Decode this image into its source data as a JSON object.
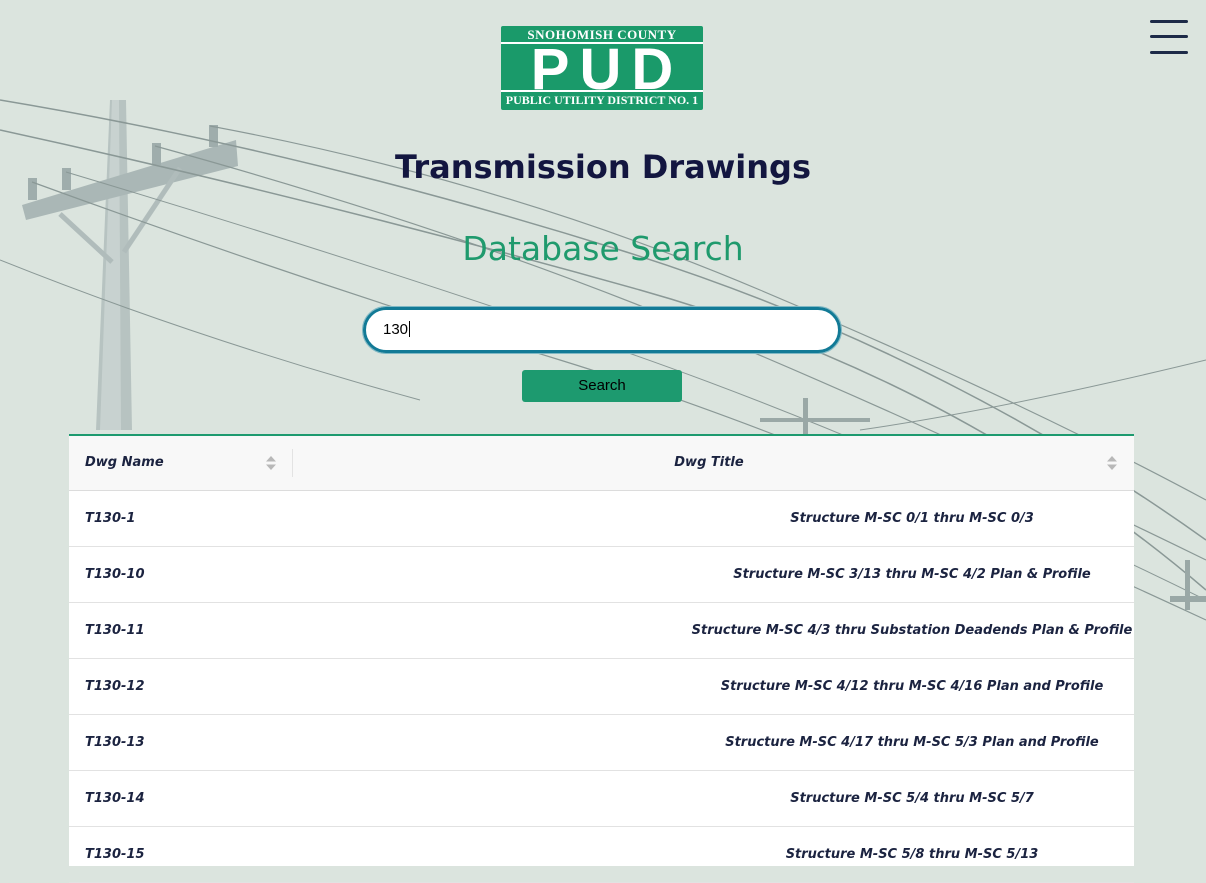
{
  "logo": {
    "top_text": "SNOHOMISH COUNTY",
    "main_text": "PUD",
    "bottom_text": "PUBLIC UTILITY DISTRICT NO. 1"
  },
  "page": {
    "title": "Transmission Drawings",
    "subtitle": "Database Search"
  },
  "search": {
    "value": "130",
    "button_label": "Search"
  },
  "table": {
    "columns": [
      "Dwg Name",
      "Dwg Title"
    ],
    "rows": [
      {
        "name": "T130-1",
        "title": "Structure M-SC 0/1 thru M-SC 0/3"
      },
      {
        "name": "T130-10",
        "title": "Structure M-SC 3/13 thru M-SC 4/2 Plan & Profile"
      },
      {
        "name": "T130-11",
        "title": "Structure M-SC 4/3 thru Substation Deadends Plan & Profile"
      },
      {
        "name": "T130-12",
        "title": "Structure M-SC 4/12 thru M-SC 4/16 Plan and Profile"
      },
      {
        "name": "T130-13",
        "title": "Structure M-SC 4/17 thru M-SC 5/3 Plan and Profile"
      },
      {
        "name": "T130-14",
        "title": "Structure M-SC 5/4 thru M-SC 5/7"
      },
      {
        "name": "T130-15",
        "title": "Structure M-SC 5/8 thru M-SC 5/13"
      }
    ]
  },
  "icons": {
    "menu": "hamburger-menu-icon",
    "sort": "sort-arrows-icon"
  },
  "colors": {
    "brand_green": "#1d9a6f",
    "navy": "#131640",
    "input_border": "#127a96"
  }
}
